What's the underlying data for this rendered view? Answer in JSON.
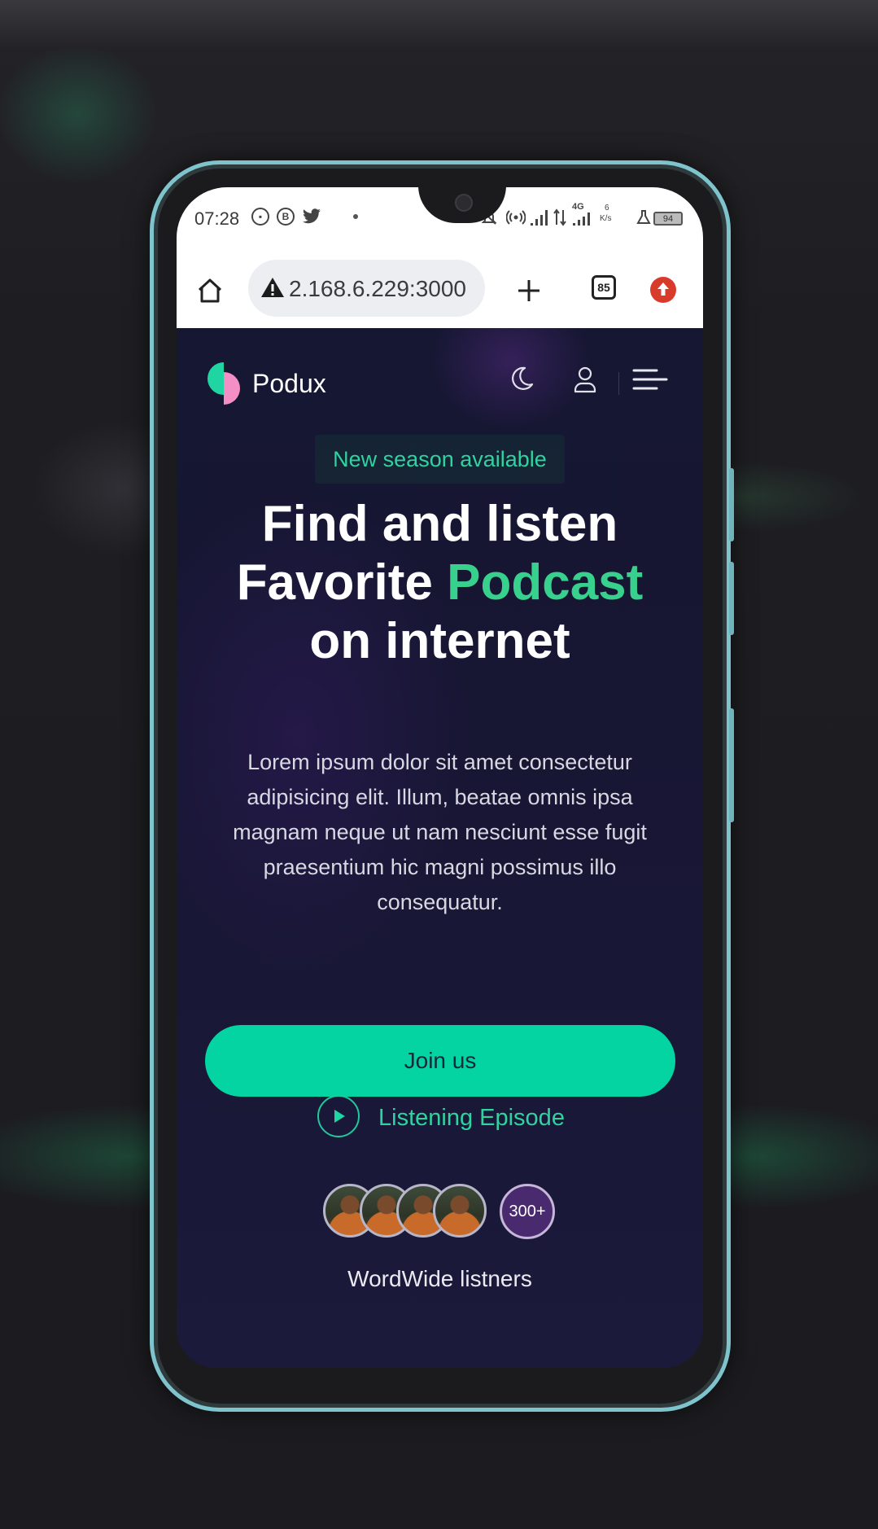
{
  "status_bar": {
    "time": "07:28",
    "network": "4G",
    "speed_value": "6",
    "speed_unit": "K/s",
    "battery": "94",
    "icons": [
      "clipboard-icon",
      "b-app-icon",
      "twitter-icon",
      "dot-icon",
      "mute-icon",
      "hotspot-icon",
      "signal-icon",
      "data-icon",
      "signal-icon",
      "flask-icon"
    ]
  },
  "browser": {
    "url": "2.168.6.229:3000",
    "tab_count": "85",
    "icons": [
      "home-icon",
      "warning-icon",
      "plus-icon",
      "tabs-icon",
      "update-icon"
    ]
  },
  "header": {
    "brand": "Podux",
    "icons": [
      "moon-icon",
      "user-icon",
      "menu-icon"
    ]
  },
  "hero": {
    "badge": "New season available",
    "headline_line1": "Find and listen",
    "headline_line2_start": "Favorite ",
    "headline_line2_accent": "Podcast",
    "headline_line3": "on internet",
    "paragraph": "Lorem ipsum dolor sit amet consectetur adipisicing elit. Illum, beatae omnis ipsa magnam neque ut nam nesciunt esse fugit praesentium hic magni possimus illo consequatur.",
    "join_label": "Join us",
    "listen_label": "Listening Episode",
    "avatars_more": "300+",
    "listeners_label": "WordWide listners"
  },
  "colors": {
    "accent": "#03d4a2",
    "accent_text": "#2fd3a0",
    "headline_accent": "#38d08d",
    "background": "#161733",
    "phone_frame": "#7fc3cc"
  }
}
